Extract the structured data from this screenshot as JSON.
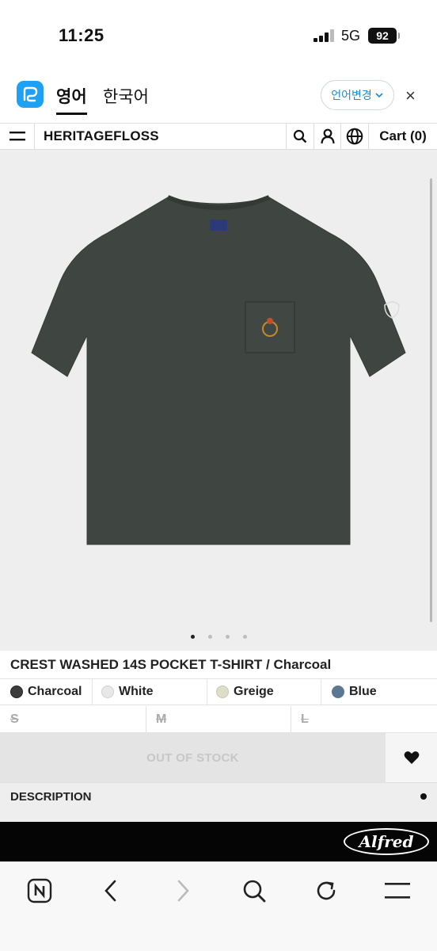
{
  "status_bar": {
    "time": "11:25",
    "network": "5G",
    "battery": "92"
  },
  "translate_bar": {
    "active_language": "영어",
    "other_language": "한국어",
    "change_button": "언어변경",
    "close_symbol": "×"
  },
  "header": {
    "brand": "HERITAGEFLOSS",
    "cart_label": "Cart (0)"
  },
  "gallery": {
    "image_count": 4,
    "active_index": 0
  },
  "product": {
    "title": "CREST WASHED 14S POCKET T-SHIRT / Charcoal",
    "colors": [
      {
        "label": "Charcoal",
        "swatch": "#3d3d3d"
      },
      {
        "label": "White",
        "swatch": "#e8e8e8"
      },
      {
        "label": "Greige",
        "swatch": "#ddddc8"
      },
      {
        "label": "Blue",
        "swatch": "#5b7791"
      }
    ],
    "sizes": [
      {
        "label": "S",
        "available": false
      },
      {
        "label": "M",
        "available": false
      },
      {
        "label": "L",
        "available": false
      }
    ],
    "buy_button": "OUT OF STOCK",
    "description_label": "DESCRIPTION"
  },
  "banner": {
    "logo_text": "Alfred"
  },
  "colors": {
    "shirt": "#3f4641",
    "accent_blue": "#1e88d2"
  }
}
